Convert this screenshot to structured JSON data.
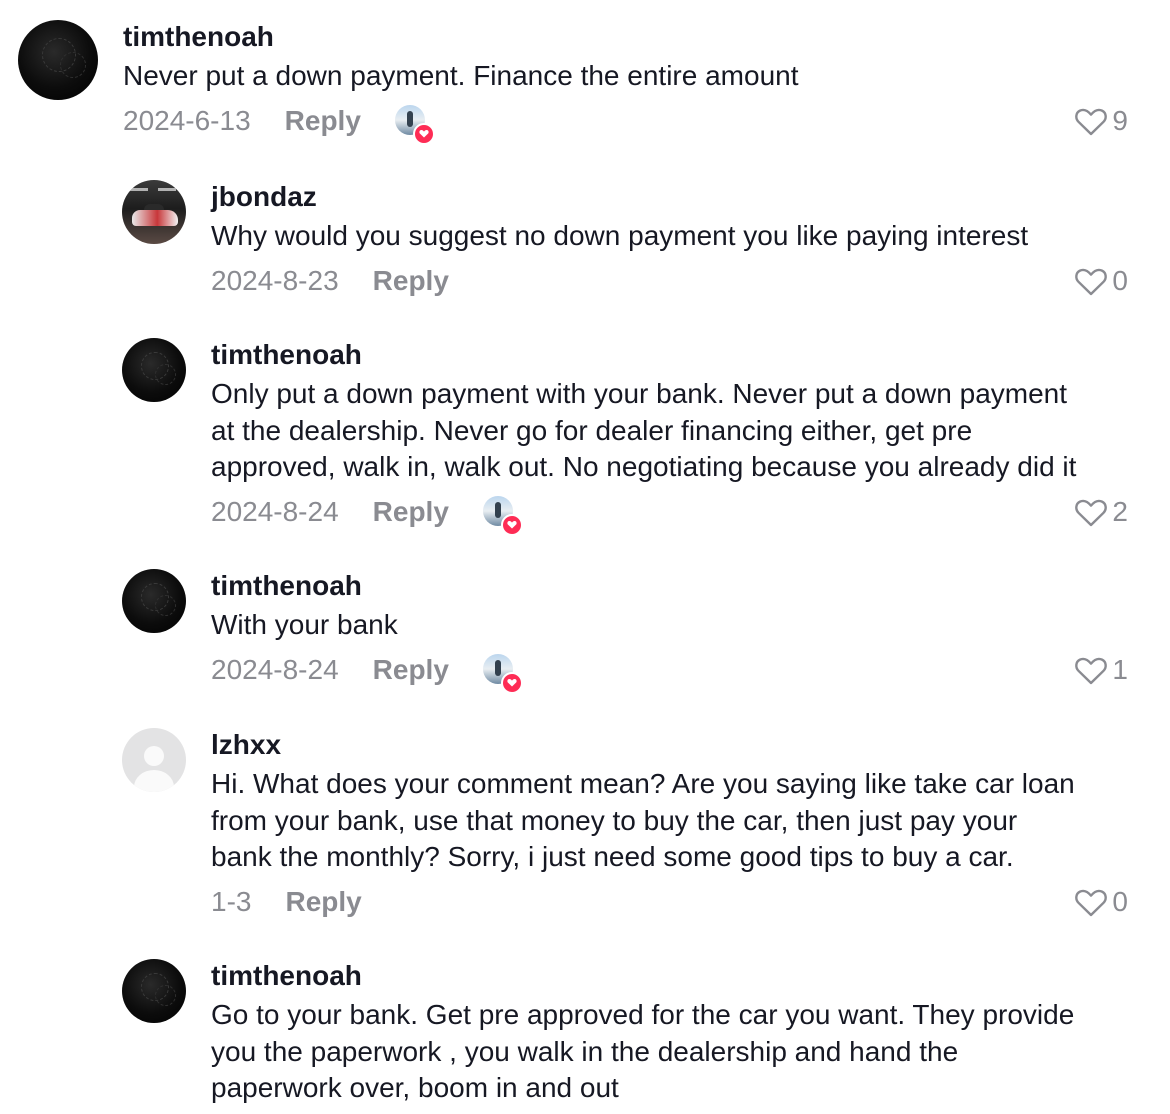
{
  "labels": {
    "reply": "Reply"
  },
  "colors": {
    "text": "#161823",
    "secondary": "#8a8b91",
    "liked_badge_heart": "#fe2c55"
  },
  "comments": [
    {
      "username": "timthenoah",
      "avatar_icon": "dark-dandelion-avatar",
      "lines": [
        "Never put a down payment. Finance the entire amount"
      ],
      "date": "2024-6-13",
      "likes": "9",
      "creator_liked": true
    },
    {
      "username": "jbondaz",
      "avatar_icon": "car-photo-avatar",
      "lines": [
        "Why would you suggest no down payment you like paying interest"
      ],
      "date": "2024-8-23",
      "likes": "0",
      "creator_liked": false
    },
    {
      "username": "timthenoah",
      "avatar_icon": "dark-dandelion-avatar",
      "lines": [
        "Only put a down payment with your bank. Never put a down payment",
        "at the dealership. Never go for dealer financing either, get pre",
        "approved, walk in, walk out. No negotiating because you already did it"
      ],
      "date": "2024-8-24",
      "likes": "2",
      "creator_liked": true
    },
    {
      "username": "timthenoah",
      "avatar_icon": "dark-dandelion-avatar",
      "lines": [
        "With your bank"
      ],
      "date": "2024-8-24",
      "likes": "1",
      "creator_liked": true
    },
    {
      "username": "lzhxx",
      "avatar_icon": "default-user-avatar",
      "lines": [
        "Hi. What does your comment mean? Are you saying like take car loan",
        "from your bank, use that money to buy the car, then just pay your",
        "bank the monthly? Sorry, i just need some good tips to buy a car."
      ],
      "date": "1-3",
      "likes": "0",
      "creator_liked": false
    },
    {
      "username": "timthenoah",
      "avatar_icon": "dark-dandelion-avatar",
      "lines": [
        "Go to your bank. Get pre approved for the car you want. They provide",
        "you the paperwork , you walk in the dealership and hand the",
        "paperwork over, boom in and out"
      ]
    }
  ]
}
